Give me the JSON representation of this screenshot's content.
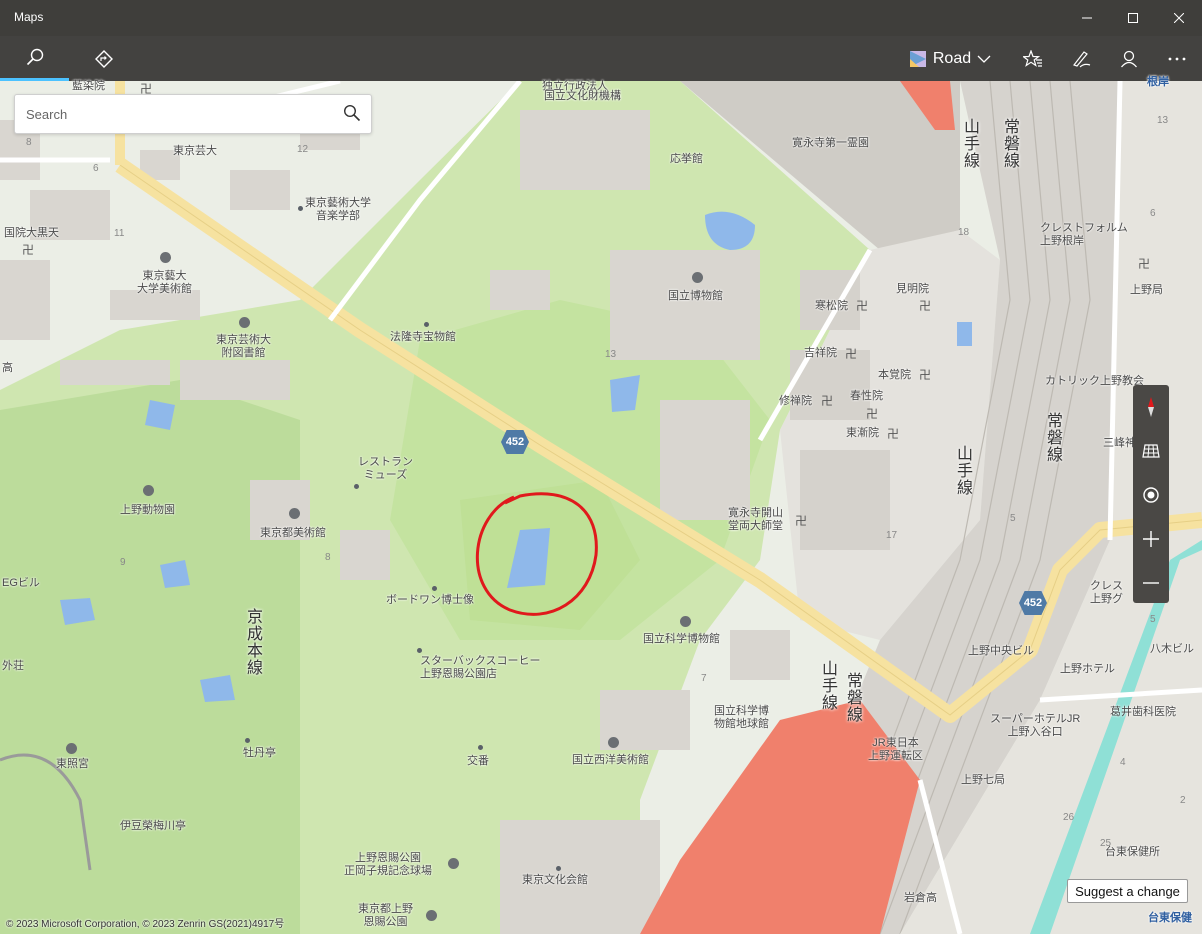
{
  "window": {
    "title": "Maps"
  },
  "toolbar": {
    "map_style": "Road"
  },
  "search": {
    "placeholder": "Search"
  },
  "map": {
    "route_shield": "452",
    "labels": {
      "kokuritsu_bunkazai": "国立文化財機構",
      "kokuritsu_bunkazai_top": "独立行政法人",
      "oushoukan": "応挙館",
      "kaneiji": "寛永寺第一霊園",
      "tokyo_geidai": "東京芸大",
      "geidai_music": "東京藝術大学\n音楽学部",
      "kokuinkurotei": "国院大黒天",
      "geidai_museum": "東京藝大\n大学美術館",
      "geidai_library": "東京芸術大\n附図書館",
      "houryuji": "法隆寺宝物館",
      "tohaku": "国立博物館",
      "kanmatsuin": "寒松院",
      "kenmyoin": "見明院",
      "kichijoin": "吉祥院",
      "honkakuin": "本覚院",
      "shuzenin": "修禅院",
      "shunshoin": "春性院",
      "tozenin": "東漸院",
      "crest_top": "クレストフォルム\n上野根岸",
      "ueno_post": "上野局",
      "catholic": "カトリック上野教会",
      "mitsuki": "三峰神",
      "restaurant": "レストラン\nミューズ",
      "ueno_zoo": "上野動物園",
      "tobikan": "東京都美術館",
      "kaneiji_ryodaishi": "寛永寺開山\n堂両大師堂",
      "boudouin": "ボードワン博士像",
      "kahaku": "国立科学博物館",
      "starbucks": "スターバックスコーヒー\n上野恩賜公園店",
      "keisei_line": "京成本線",
      "kahaku_planet": "国立科学博\n物館地球館",
      "seiyo": "国立西洋美術館",
      "koban": "交番",
      "toshogu": "東照宮",
      "botan": "牡丹亭",
      "izu_ume": "伊豆榮梅川亭",
      "seiki_stadium": "上野恩賜公園\n正岡子規記念球場",
      "bunka_kaikan": "東京文化会館",
      "ueno_koen_mgmt": "東京都上野\n恩賜公園",
      "yamanote1": "山手線",
      "joban1": "常磐線",
      "yamanote2": "山手線",
      "joban2": "常磐線",
      "yamanote3": "山手線",
      "joban3": "常磐線",
      "ueno_chuo": "上野中央ビル",
      "ueno_hotel": "上野ホテル",
      "super_hotel": "スーパーホテルJR\n上野入谷口",
      "jr_east": "JR東日本\n上野運転区",
      "ueno7": "上野七局",
      "kuzui": "葛井歯科医院",
      "yatsuhiro": "八木ビル",
      "crest_bottom": "クレス\n上野グ",
      "taito_hoken": "台東保健所",
      "iwakura": "岩倉高",
      "taito_hoken_bottom": "台東保健",
      "gaikan": "外荘",
      "egbld": "EGビル",
      "kou": "高",
      "hachiman": "藍染院",
      "negishi": "根岸"
    },
    "block_numbers": [
      "12",
      "8",
      "6",
      "11",
      "13",
      "13",
      "18",
      "17",
      "5",
      "7",
      "8",
      "9",
      "6",
      "26",
      "25",
      "2",
      "4",
      "5"
    ]
  },
  "controls": {
    "suggest_change": "Suggest a change"
  },
  "copyright": "© 2023 Microsoft Corporation, © 2023 Zenrin GS(2021)4917号",
  "colors": {
    "titlebar": "#3f3e3b",
    "accent": "#4cc2ff",
    "park": "#c8e6a8",
    "arterial": "#f6e2a0",
    "water": "#8fb8ea",
    "rail_platform": "#f0806c",
    "annotation_circle": "#e0191c"
  }
}
